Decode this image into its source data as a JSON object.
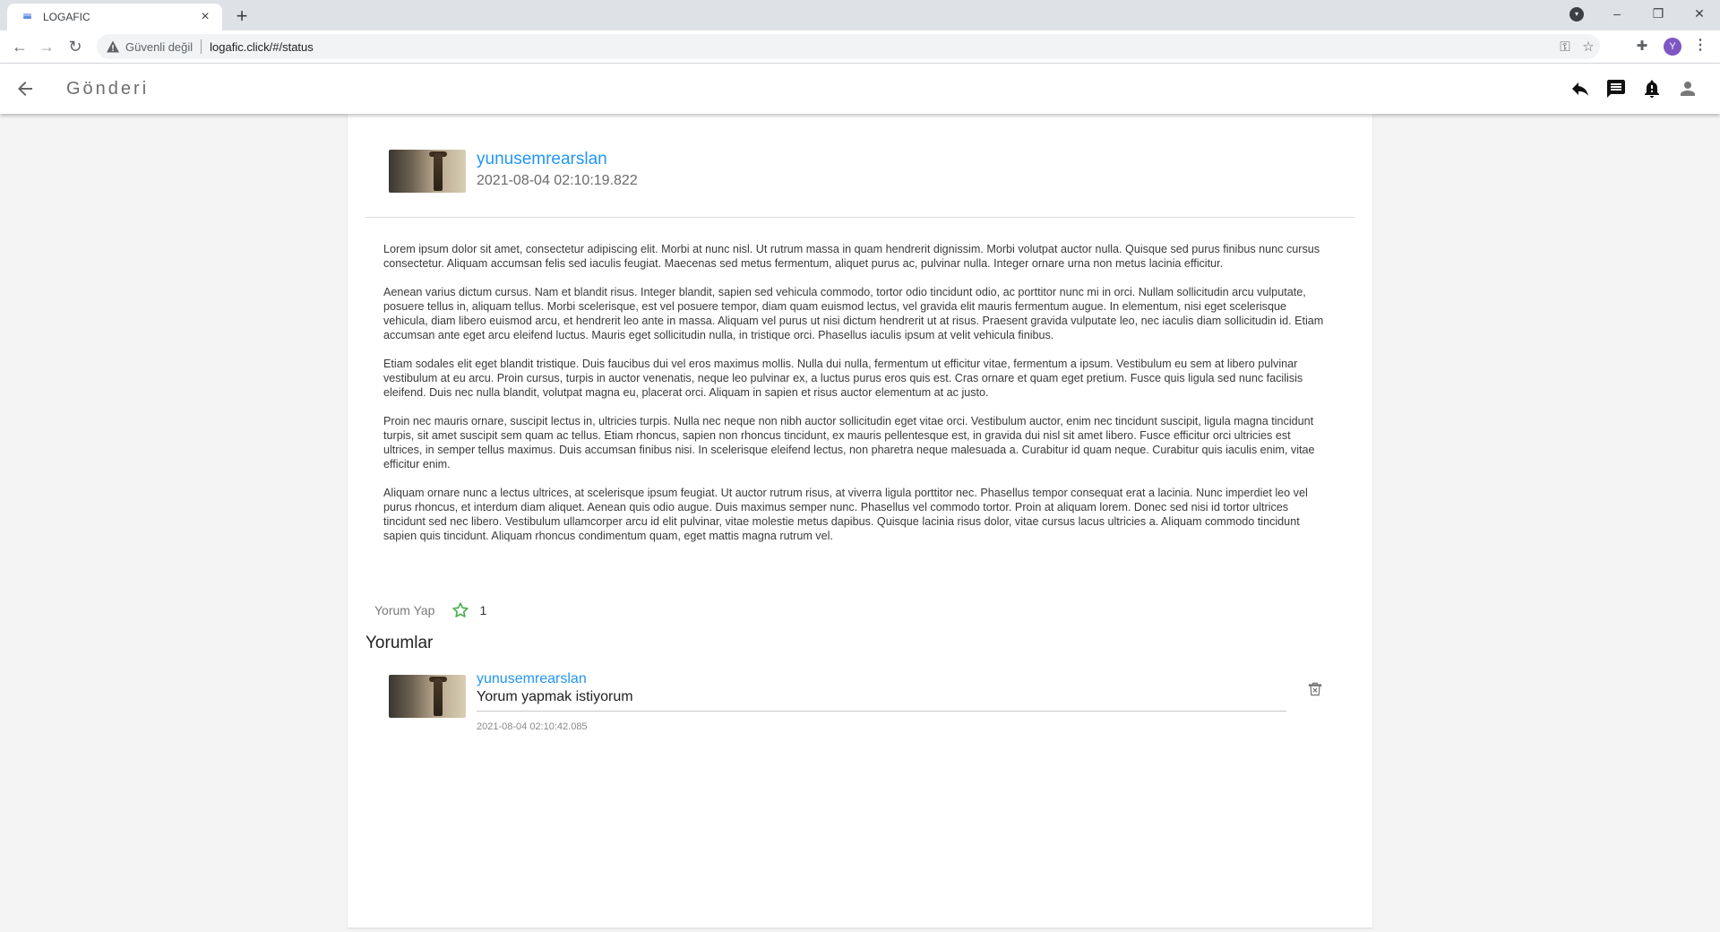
{
  "browser": {
    "tab_title": "LOGAFIC",
    "tab_close": "×",
    "new_tab": "+",
    "security_label": "Güvenli değil",
    "url": "logafic.click/#/status",
    "profile_initial": "Y",
    "window_controls": {
      "minimize": "–",
      "restore": "❐",
      "close": "✕"
    }
  },
  "appbar": {
    "title": "Gönderi",
    "icons": [
      "back-arrow-icon",
      "reply-icon",
      "chat-icon",
      "bell-icon",
      "account-icon"
    ]
  },
  "post": {
    "author": "yunusemrearslan",
    "timestamp": "2021-08-04 02:10:19.822",
    "paragraphs": [
      "Lorem ipsum dolor sit amet, consectetur adipiscing elit. Morbi at nunc nisl. Ut rutrum massa in quam hendrerit dignissim. Morbi volutpat auctor nulla. Quisque sed purus finibus nunc cursus consectetur. Aliquam accumsan felis sed iaculis feugiat. Maecenas sed metus fermentum, aliquet purus ac, pulvinar nulla. Integer ornare urna non metus lacinia efficitur.",
      "Aenean varius dictum cursus. Nam et blandit risus. Integer blandit, sapien sed vehicula commodo, tortor odio tincidunt odio, ac porttitor nunc mi in orci. Nullam sollicitudin arcu vulputate, posuere tellus in, aliquam tellus. Morbi scelerisque, est vel posuere tempor, diam quam euismod lectus, vel gravida elit mauris fermentum augue. In elementum, nisi eget scelerisque vehicula, diam libero euismod arcu, et hendrerit leo ante in massa. Aliquam vel purus ut nisi dictum hendrerit ut at risus. Praesent gravida vulputate leo, nec iaculis diam sollicitudin id. Etiam accumsan ante eget arcu eleifend luctus. Mauris eget sollicitudin nulla, in tristique orci. Phasellus iaculis ipsum at velit vehicula finibus.",
      "Etiam sodales elit eget blandit tristique. Duis faucibus dui vel eros maximus mollis. Nulla dui nulla, fermentum ut efficitur vitae, fermentum a ipsum. Vestibulum eu sem at libero pulvinar vestibulum at eu arcu. Proin cursus, turpis in auctor venenatis, neque leo pulvinar ex, a luctus purus eros quis est. Cras ornare et quam eget pretium. Fusce quis ligula sed nunc facilisis eleifend. Duis nec nulla blandit, volutpat magna eu, placerat orci. Aliquam in sapien et risus auctor elementum at ac justo.",
      "Proin nec mauris ornare, suscipit lectus in, ultricies turpis. Nulla nec neque non nibh auctor sollicitudin eget vitae orci. Vestibulum auctor, enim nec tincidunt suscipit, ligula magna tincidunt turpis, sit amet suscipit sem quam ac tellus. Etiam rhoncus, sapien non rhoncus tincidunt, ex mauris pellentesque est, in gravida dui nisl sit amet libero. Fusce efficitur orci ultricies est ultrices, in semper tellus maximus. Duis accumsan finibus nisi. In scelerisque eleifend lectus, non pharetra neque malesuada a. Curabitur id quam neque. Curabitur quis iaculis enim, vitae efficitur enim.",
      "Aliquam ornare nunc a lectus ultrices, at scelerisque ipsum feugiat. Ut auctor rutrum risus, at viverra ligula porttitor nec. Phasellus tempor consequat erat a lacinia. Nunc imperdiet leo vel purus rhoncus, et interdum diam aliquet. Aenean quis odio augue. Duis maximus semper nunc. Phasellus vel commodo tortor. Proin at aliquam lorem. Donec sed nisi id tortor ultrices tincidunt sed nec libero. Vestibulum ullamcorper arcu id elit pulvinar, vitae molestie metus dapibus. Quisque lacinia risus dolor, vitae cursus lacus ultricies a. Aliquam commodo tincidunt sapien quis tincidunt. Aliquam rhoncus condimentum quam, eget mattis magna rutrum vel."
    ],
    "comment_button": "Yorum Yap",
    "like_count": "1"
  },
  "comments": {
    "heading": "Yorumlar",
    "items": [
      {
        "author": "yunusemrearslan",
        "text": "Yorum yapmak istiyorum",
        "timestamp": "2021-08-04 02:10:42.085"
      }
    ]
  },
  "colors": {
    "link": "#2196f3",
    "star": "#4caf50",
    "avatar_profile": "#7e57c2"
  }
}
